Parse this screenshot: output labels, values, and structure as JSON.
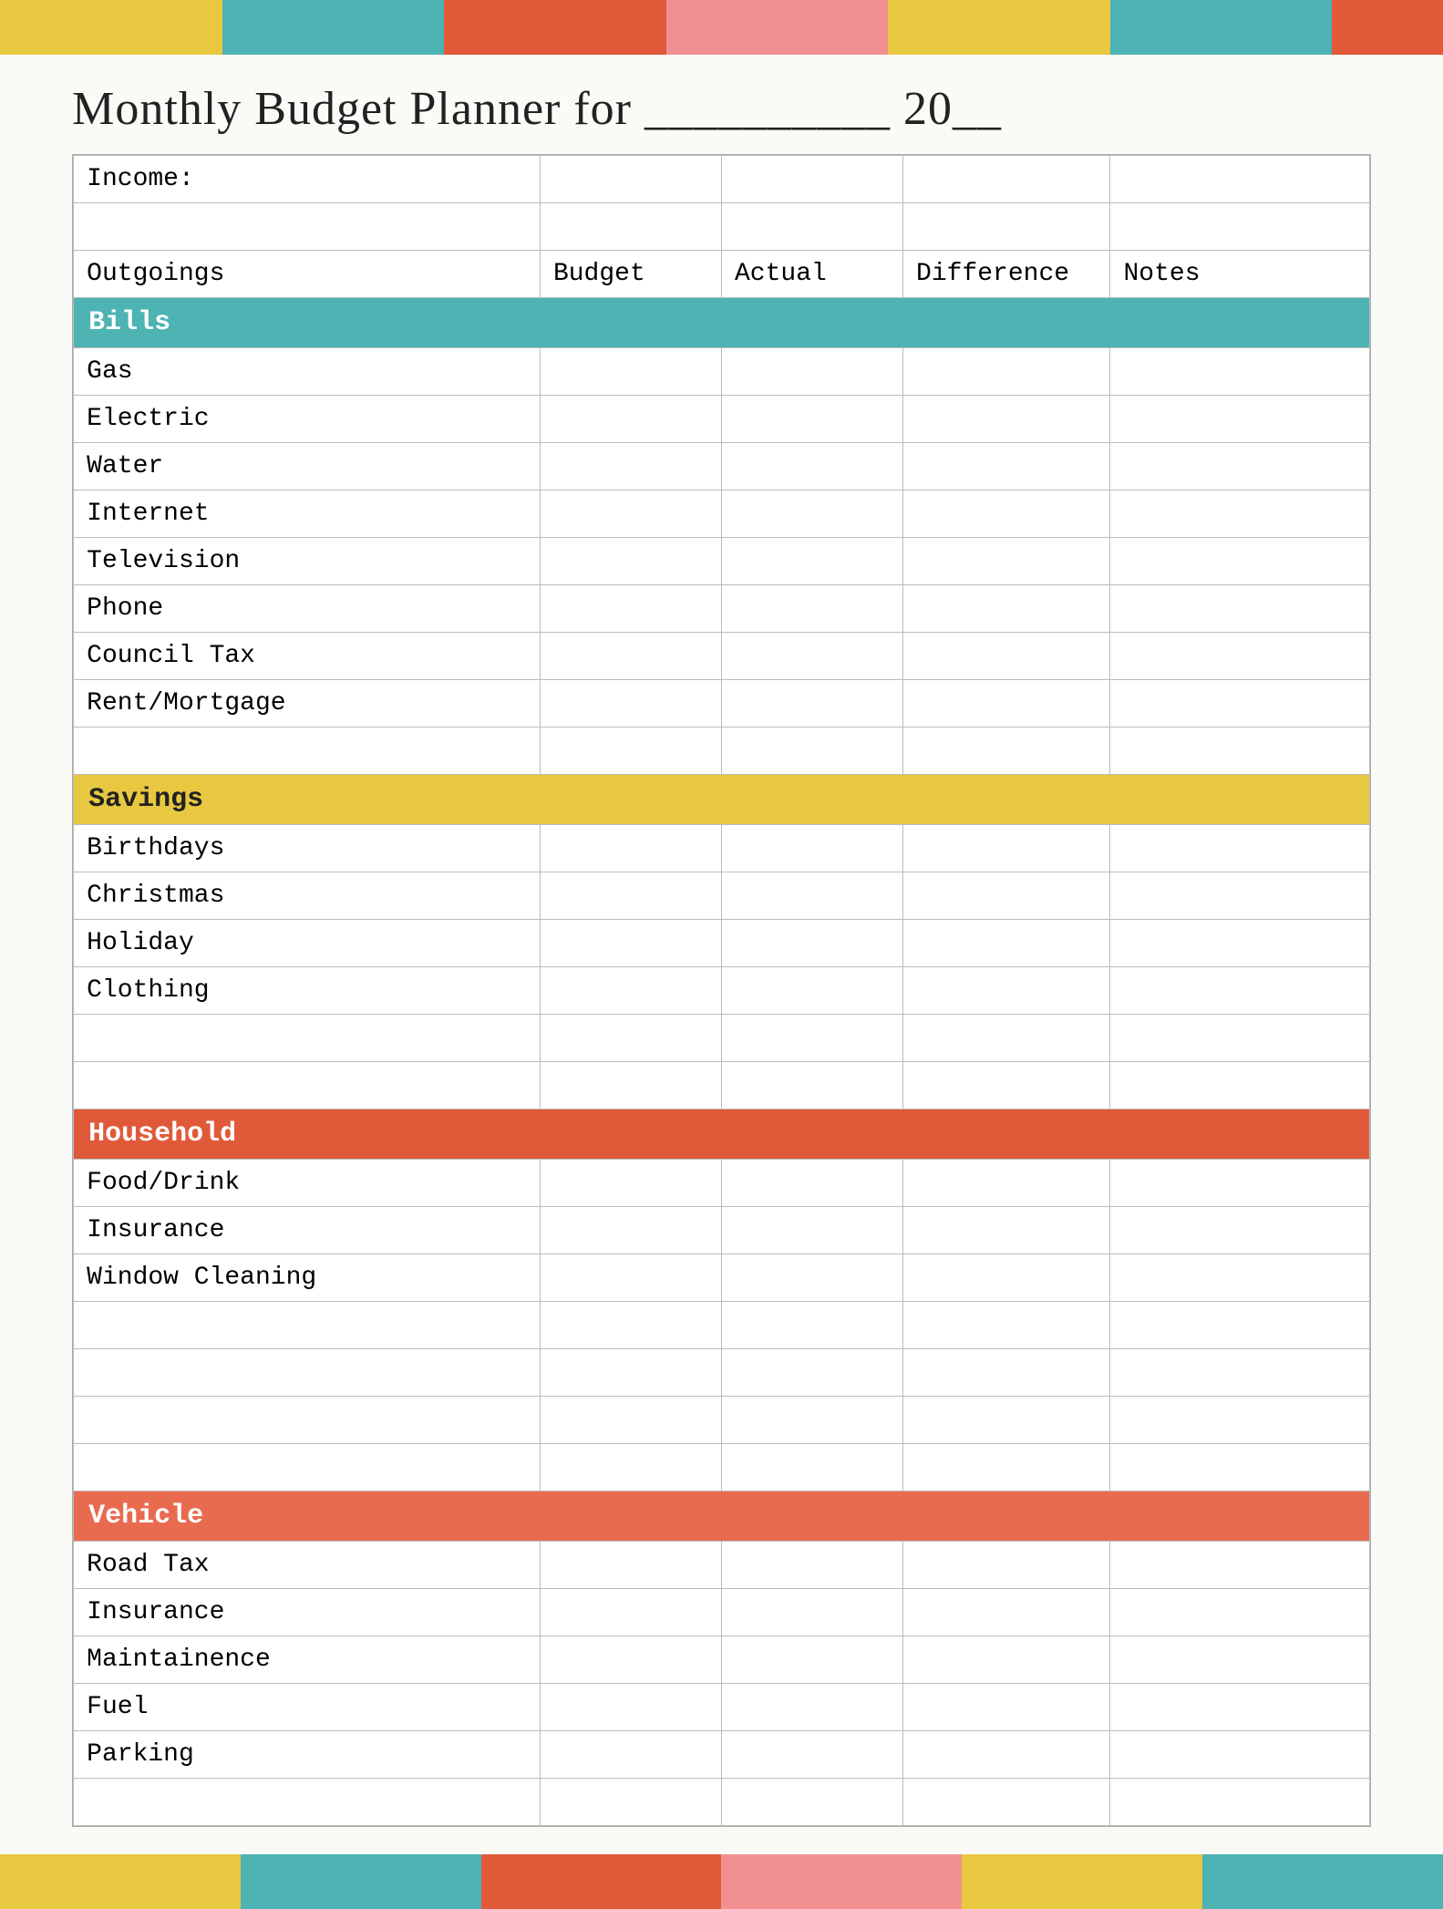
{
  "topBar": [
    {
      "color": "#e8c840",
      "flex": 2
    },
    {
      "color": "#4db3b3",
      "flex": 2
    },
    {
      "color": "#e05a3a",
      "flex": 2
    },
    {
      "color": "#f09090",
      "flex": 2
    },
    {
      "color": "#e8c840",
      "flex": 2
    },
    {
      "color": "#4db3b3",
      "flex": 2
    },
    {
      "color": "#e05a3a",
      "flex": 1
    }
  ],
  "bottomBar": [
    {
      "color": "#e8c840",
      "flex": 2
    },
    {
      "color": "#4db3b3",
      "flex": 2
    },
    {
      "color": "#e05a3a",
      "flex": 2
    },
    {
      "color": "#f09090",
      "flex": 2
    },
    {
      "color": "#e8c840",
      "flex": 2
    },
    {
      "color": "#4db3b3",
      "flex": 2
    }
  ],
  "title": "Monthly Budget Planner for __________ 20__",
  "columns": {
    "outgoings": "Outgoings",
    "budget": "Budget",
    "actual": "Actual",
    "difference": "Difference",
    "notes": "Notes"
  },
  "income_label": "Income:",
  "sections": {
    "bills": {
      "label": "Bills",
      "items": [
        "Gas",
        "Electric",
        "Water",
        "Internet",
        "Television",
        "Phone",
        "Council Tax",
        "Rent/Mortgage"
      ]
    },
    "savings": {
      "label": "Savings",
      "items": [
        "Birthdays",
        "Christmas",
        "Holiday",
        "Clothing"
      ]
    },
    "household": {
      "label": "Household",
      "items": [
        "Food/Drink",
        "Insurance",
        "Window Cleaning"
      ]
    },
    "vehicle": {
      "label": "Vehicle",
      "items": [
        "Road Tax",
        "Insurance",
        "Maintainence",
        "Fuel",
        "Parking"
      ]
    }
  }
}
